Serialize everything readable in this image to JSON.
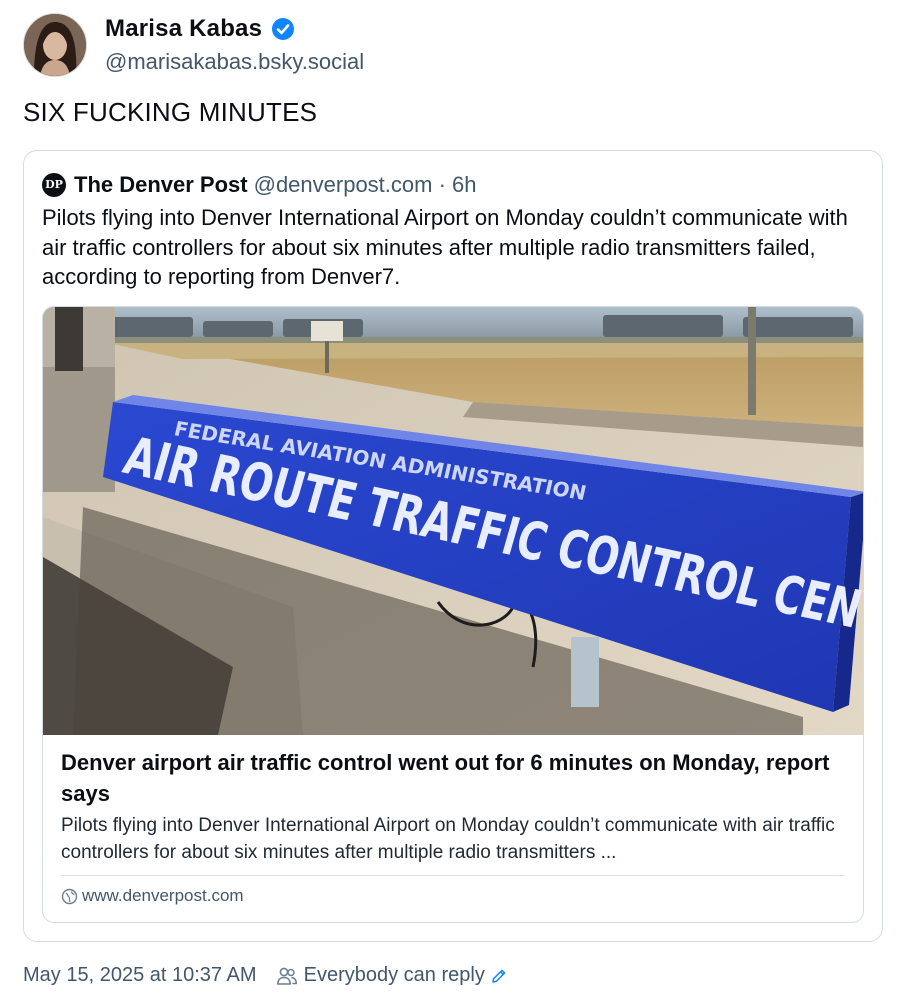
{
  "author": {
    "display_name": "Marisa Kabas",
    "handle": "@marisakabas.bsky.social",
    "avatar_icon": "avatar-photo",
    "verified_icon": "verified-badge-icon",
    "verified_color": "#1185fe"
  },
  "post": {
    "text": "SIX FUCKING MINUTES"
  },
  "quote": {
    "author_name": "The Denver Post",
    "author_handle": "@denverpost.com · 6h",
    "logo_text": "DP",
    "text": "Pilots flying into Denver International Airport on Monday couldn’t communicate with air traffic controllers for about six minutes after multiple radio transmitters failed, according to reporting from Denver7.",
    "card": {
      "title": "Denver airport air traffic control went out for 6 minutes on Monday, report says",
      "description": "Pilots flying into Denver International Airport on Monday couldn’t communicate with air traffic controllers for about six minutes after multiple radio transmitters ...",
      "domain": "www.denverpost.com",
      "image": {
        "sign_line1": "FEDERAL AVIATION ADMINISTRATION",
        "sign_line2": "AIR ROUTE TRAFFIC CONTROL CENTER"
      }
    }
  },
  "footer": {
    "timestamp": "May 15, 2025 at 10:37 AM",
    "reply_setting": "Everybody can reply"
  },
  "colors": {
    "text_primary": "#0b0f14",
    "text_secondary": "#42576c",
    "border": "#d4dbe2",
    "sign_blue": "#2442c9"
  }
}
